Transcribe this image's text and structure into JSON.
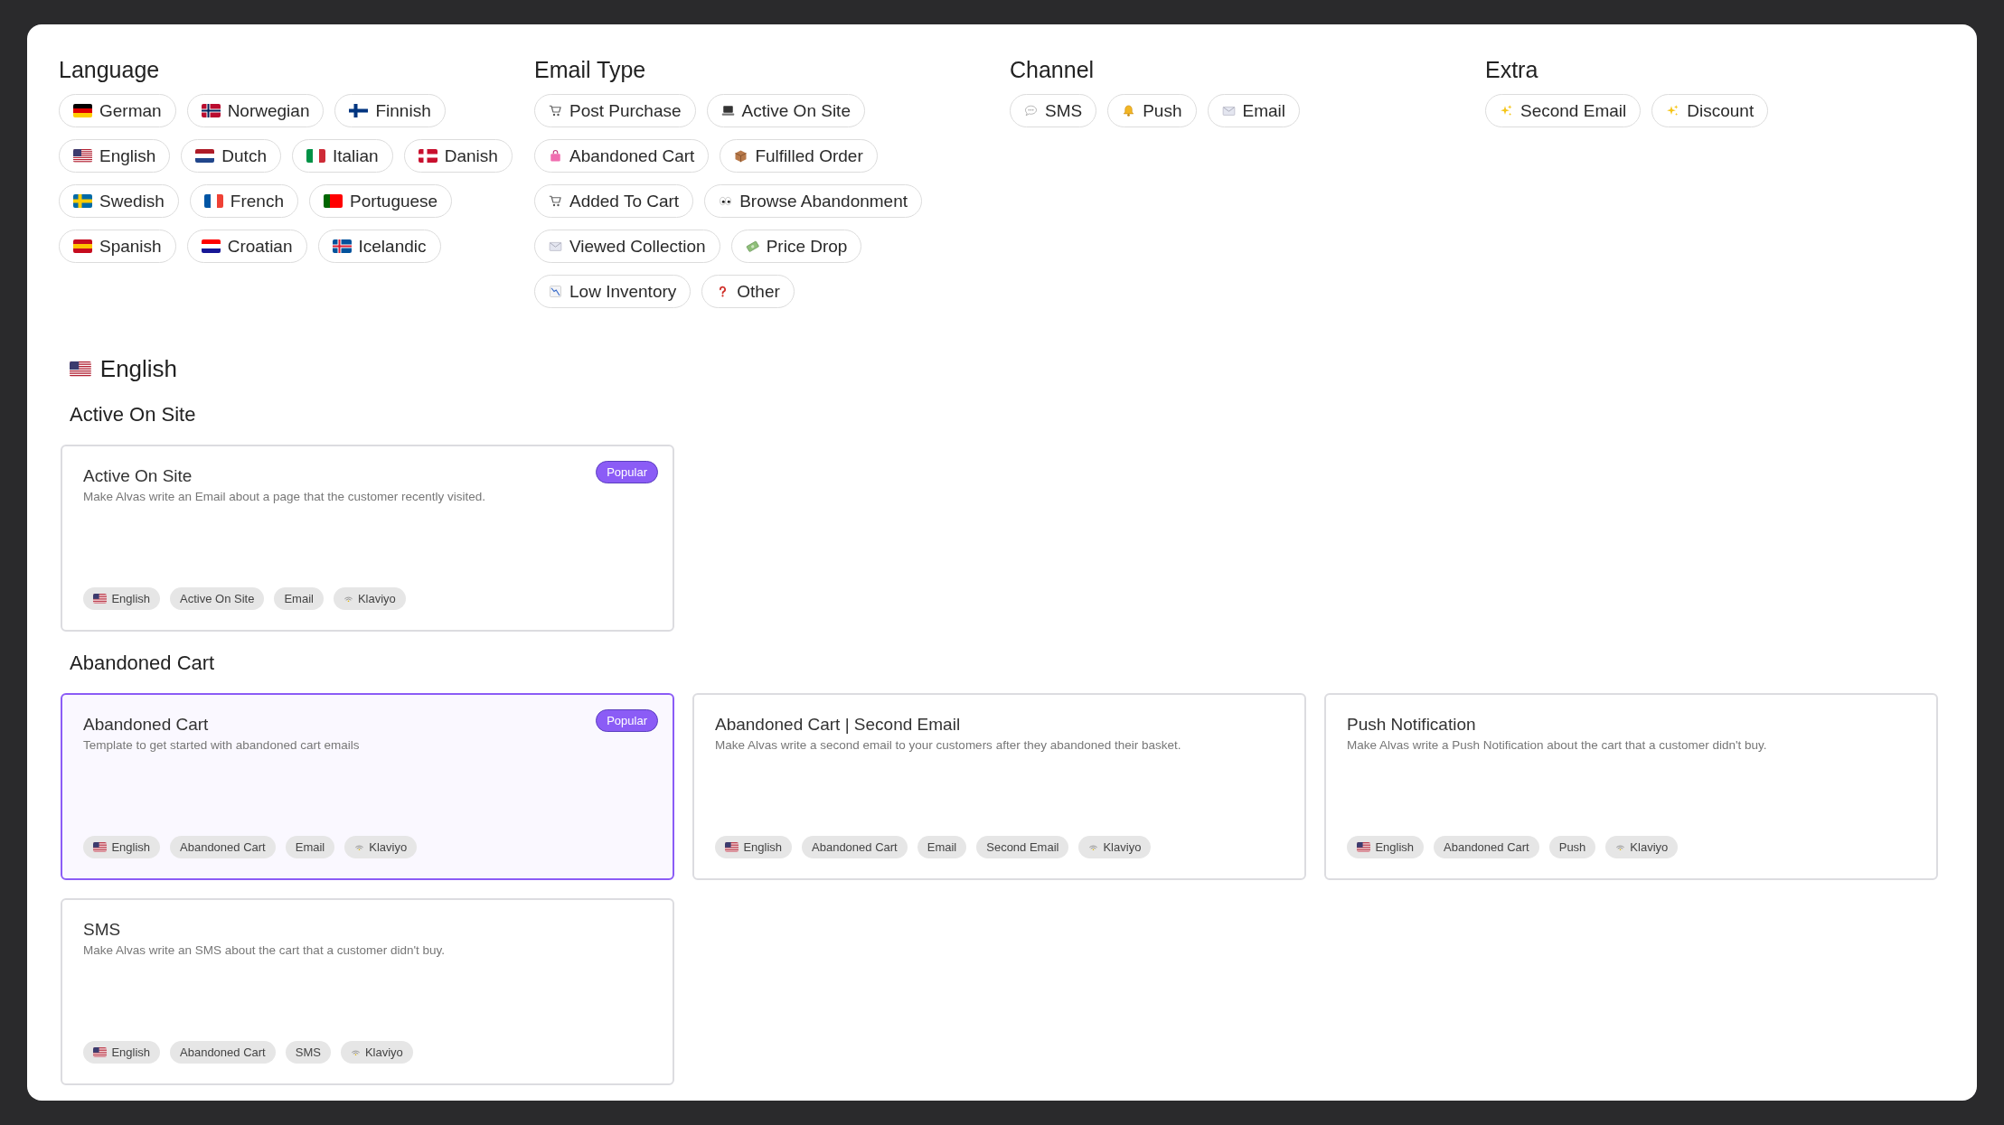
{
  "filter_groups": [
    {
      "title": "Language",
      "options": [
        {
          "label": "German",
          "icon": {
            "kind": "flag-de"
          }
        },
        {
          "label": "Norwegian",
          "icon": {
            "kind": "flag-no"
          }
        },
        {
          "label": "Finnish",
          "icon": {
            "kind": "flag-fi"
          }
        },
        {
          "label": "English",
          "icon": {
            "kind": "flag-us"
          }
        },
        {
          "label": "Dutch",
          "icon": {
            "kind": "flag-nl"
          }
        },
        {
          "label": "Italian",
          "icon": {
            "kind": "flag-it"
          }
        },
        {
          "label": "Danish",
          "icon": {
            "kind": "flag-dk"
          }
        },
        {
          "label": "Swedish",
          "icon": {
            "kind": "flag-se"
          }
        },
        {
          "label": "French",
          "icon": {
            "kind": "flag-fr"
          }
        },
        {
          "label": "Portuguese",
          "icon": {
            "kind": "flag-pt"
          }
        },
        {
          "label": "Spanish",
          "icon": {
            "kind": "flag-es"
          }
        },
        {
          "label": "Croatian",
          "icon": {
            "kind": "flag-hr"
          }
        },
        {
          "label": "Icelandic",
          "icon": {
            "kind": "flag-is"
          }
        }
      ]
    },
    {
      "title": "Email Type",
      "options": [
        {
          "label": "Post Purchase",
          "icon": {
            "kind": "cart"
          }
        },
        {
          "label": "Active On Site",
          "icon": {
            "kind": "laptop"
          }
        },
        {
          "label": "Abandoned Cart",
          "icon": {
            "kind": "bag"
          }
        },
        {
          "label": "Fulfilled Order",
          "icon": {
            "kind": "package"
          }
        },
        {
          "label": "Added To Cart",
          "icon": {
            "kind": "cart"
          }
        },
        {
          "label": "Browse Abandonment",
          "icon": {
            "kind": "eyes"
          }
        },
        {
          "label": "Viewed Collection",
          "icon": {
            "kind": "envelope"
          }
        },
        {
          "label": "Price Drop",
          "icon": {
            "kind": "money"
          }
        },
        {
          "label": "Low Inventory",
          "icon": {
            "kind": "chart-down"
          }
        },
        {
          "label": "Other",
          "icon": {
            "kind": "question"
          }
        }
      ]
    },
    {
      "title": "Channel",
      "options": [
        {
          "label": "SMS",
          "icon": {
            "kind": "speech"
          }
        },
        {
          "label": "Push",
          "icon": {
            "kind": "bell"
          }
        },
        {
          "label": "Email",
          "icon": {
            "kind": "envelope"
          }
        }
      ]
    },
    {
      "title": "Extra",
      "options": [
        {
          "label": "Second Email",
          "icon": {
            "kind": "sparkles"
          }
        },
        {
          "label": "Discount",
          "icon": {
            "kind": "sparkles"
          }
        }
      ]
    }
  ],
  "language_heading": {
    "label": "English",
    "icon": {
      "kind": "flag-us"
    }
  },
  "sections": [
    {
      "title": "Active On Site",
      "cards": [
        {
          "title": "Active On Site",
          "description": "Make Alvas write an Email about a page that the customer recently visited.",
          "badge": "Popular",
          "selected": false,
          "tags": [
            {
              "label": "English",
              "icon": {
                "kind": "flag-us"
              }
            },
            {
              "label": "Active On Site"
            },
            {
              "label": "Email"
            },
            {
              "label": "Klaviyo",
              "icon": {
                "kind": "signal"
              }
            }
          ]
        }
      ]
    },
    {
      "title": "Abandoned Cart",
      "cards": [
        {
          "title": "Abandoned Cart",
          "description": "Template to get started with abandoned cart emails",
          "badge": "Popular",
          "selected": true,
          "tags": [
            {
              "label": "English",
              "icon": {
                "kind": "flag-us"
              }
            },
            {
              "label": "Abandoned Cart"
            },
            {
              "label": "Email"
            },
            {
              "label": "Klaviyo",
              "icon": {
                "kind": "signal"
              }
            }
          ]
        },
        {
          "title": "Abandoned Cart | Second Email",
          "description": "Make Alvas write a second email to your customers after they abandoned their basket.",
          "selected": false,
          "tags": [
            {
              "label": "English",
              "icon": {
                "kind": "flag-us"
              }
            },
            {
              "label": "Abandoned Cart"
            },
            {
              "label": "Email"
            },
            {
              "label": "Second Email"
            },
            {
              "label": "Klaviyo",
              "icon": {
                "kind": "signal"
              }
            }
          ]
        },
        {
          "title": "Push Notification",
          "description": "Make Alvas write a Push Notification about the cart that a customer didn't buy.",
          "selected": false,
          "tags": [
            {
              "label": "English",
              "icon": {
                "kind": "flag-us"
              }
            },
            {
              "label": "Abandoned Cart"
            },
            {
              "label": "Push"
            },
            {
              "label": "Klaviyo",
              "icon": {
                "kind": "signal"
              }
            }
          ]
        },
        {
          "title": "SMS",
          "description": "Make Alvas write an SMS about the cart that a customer didn't buy.",
          "selected": false,
          "tags": [
            {
              "label": "English",
              "icon": {
                "kind": "flag-us"
              }
            },
            {
              "label": "Abandoned Cart"
            },
            {
              "label": "SMS"
            },
            {
              "label": "Klaviyo",
              "icon": {
                "kind": "signal"
              }
            }
          ]
        }
      ]
    }
  ]
}
